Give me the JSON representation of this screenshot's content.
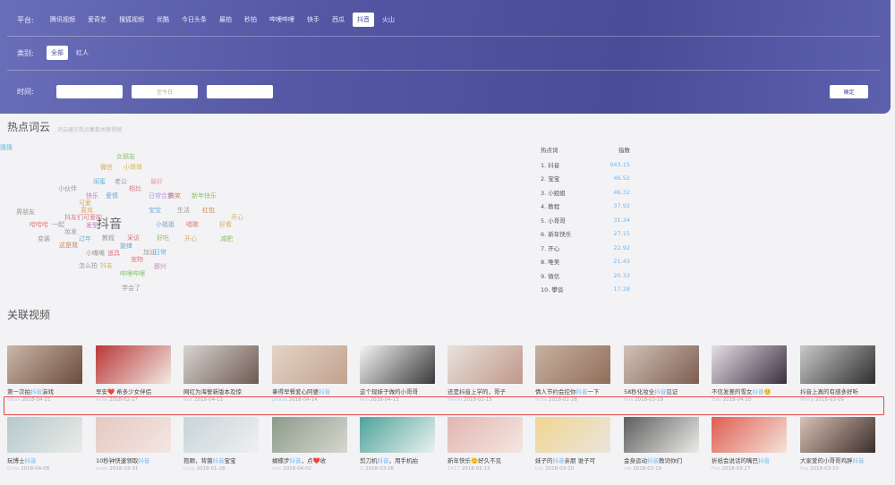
{
  "filters": {
    "platform": {
      "label": "平台:",
      "options": [
        "腾讯视频",
        "爱奇艺",
        "搜狐视频",
        "优酷",
        "今日头条",
        "最拍",
        "秒拍",
        "哔哩哔哩",
        "快手",
        "西瓜",
        "抖音",
        "火山"
      ],
      "active": "抖音"
    },
    "category": {
      "label": "类别:",
      "options": [
        "全部",
        "红人"
      ],
      "active": "全部"
    },
    "time": {
      "label": "时间:",
      "inputs": [
        "",
        "至今日",
        ""
      ],
      "confirm_label": "确定"
    }
  },
  "word_cloud": {
    "title": "热点词云",
    "note": "词云展示热点集数关联视频",
    "words": [
      {
        "text": "抖音",
        "color": "#666666",
        "big": true
      },
      {
        "text": "女朋友",
        "color": "#8bbf6c"
      },
      {
        "text": "微信",
        "color": "#e0a45a"
      },
      {
        "text": "小哥哥",
        "color": "#d9b34a"
      },
      {
        "text": "闺蜜",
        "color": "#6fb0d6"
      },
      {
        "text": "老公",
        "color": "#999999"
      },
      {
        "text": "最好",
        "color": "#e79c9c"
      },
      {
        "text": "小伙伴",
        "color": "#999999"
      },
      {
        "text": "快乐",
        "color": "#c27bc2"
      },
      {
        "text": "爱情",
        "color": "#77a3cc"
      },
      {
        "text": "相比",
        "color": "#e07777"
      },
      {
        "text": "可爱",
        "color": "#e0a45a"
      },
      {
        "text": "日常合集",
        "color": "#b995d9"
      },
      {
        "text": "搞笑",
        "color": "#cc8855"
      },
      {
        "text": "新年快乐",
        "color": "#8bbf6c"
      },
      {
        "text": "喜欢",
        "color": "#e0a45a"
      },
      {
        "text": "宝宝",
        "color": "#6fb0d6"
      },
      {
        "text": "生活",
        "color": "#999999"
      },
      {
        "text": "红包",
        "color": "#cc8855"
      },
      {
        "text": "男朋友",
        "color": "#999999"
      },
      {
        "text": "抖友们可爱的",
        "color": "#e07777"
      },
      {
        "text": "发型",
        "color": "#c27bc2"
      },
      {
        "text": "小姐姐",
        "color": "#77a3cc"
      },
      {
        "text": "教程",
        "color": "#999999"
      },
      {
        "text": "开心",
        "color": "#d9b34a"
      },
      {
        "text": "哈哈哈",
        "color": "#e07777"
      },
      {
        "text": "一起",
        "color": "#999999"
      },
      {
        "text": "妆发",
        "color": "#999999"
      },
      {
        "text": "唱歌",
        "color": "#e07777"
      },
      {
        "text": "好看",
        "color": "#d9b34a"
      },
      {
        "text": "变装",
        "color": "#999999"
      },
      {
        "text": "过年",
        "color": "#6fb0d6"
      },
      {
        "text": "采访",
        "color": "#e07777"
      },
      {
        "text": "好吃",
        "color": "#8bbf6c"
      },
      {
        "text": "开心",
        "color": "#e0a45a"
      },
      {
        "text": "减肥",
        "color": "#8bbf6c"
      },
      {
        "text": "这是我",
        "color": "#cc8855"
      },
      {
        "text": "旋律",
        "color": "#77a3cc"
      },
      {
        "text": "小嘴嘴",
        "color": "#999999"
      },
      {
        "text": "道具",
        "color": "#e07777"
      },
      {
        "text": "加油",
        "color": "#999999"
      },
      {
        "text": "日常",
        "color": "#6fb0d6"
      },
      {
        "text": "怎么拍",
        "color": "#999999"
      },
      {
        "text": "宠物",
        "color": "#e07777"
      },
      {
        "text": "抖友",
        "color": "#d9b34a"
      },
      {
        "text": "即兴",
        "color": "#c27bc2"
      },
      {
        "text": "哔哩哔哩",
        "color": "#8bbf6c"
      },
      {
        "text": "学会了",
        "color": "#999999"
      },
      {
        "text": "猜猜",
        "color": "#6fb0d6"
      }
    ]
  },
  "hot_words": {
    "header_word": "热点词",
    "header_heat": "指数",
    "rows": [
      {
        "rank": "1.",
        "word": "抖音",
        "heat": "943.15"
      },
      {
        "rank": "2.",
        "word": "宝宝",
        "heat": "46.52"
      },
      {
        "rank": "3.",
        "word": "小姐姐",
        "heat": "46.32"
      },
      {
        "rank": "4.",
        "word": "教程",
        "heat": "37.92"
      },
      {
        "rank": "5.",
        "word": "小哥哥",
        "heat": "31.34"
      },
      {
        "rank": "6.",
        "word": "新年快乐",
        "heat": "27.15"
      },
      {
        "rank": "7.",
        "word": "开心",
        "heat": "22.92"
      },
      {
        "rank": "8.",
        "word": "唯美",
        "heat": "21.43"
      },
      {
        "rank": "9.",
        "word": "微信",
        "heat": "20.32"
      },
      {
        "rank": "10.",
        "word": "攀谈",
        "heat": "17.28"
      }
    ]
  },
  "related_videos": {
    "title": "关联视频",
    "row1": [
      {
        "title_pre": "第一次拍",
        "title_hl": "抖音",
        "title_post": "演戏",
        "author": "eikan",
        "date": "2018-04-21"
      },
      {
        "title_pre": "早安❤️ 希多",
        "title_hl": "",
        "title_post": "少女伴侣",
        "author": "echo",
        "date": "2018-02-27"
      },
      {
        "title_pre": "网红为海誓新版本及惊",
        "title_hl": "",
        "title_post": "",
        "author": "fast",
        "date": "2018-04-11"
      },
      {
        "title_pre": "拿得早餐爱心阿婆",
        "title_hl": "抖音",
        "title_post": "",
        "author": "pitaus",
        "date": "2018-04-14"
      },
      {
        "title_pre": "这个现妹子做的小哥哥",
        "title_hl": "",
        "title_post": "",
        "author": "ken",
        "date": "2018-04-13"
      },
      {
        "title_pre": "还是抖音上学的，哥子",
        "title_hl": "",
        "title_post": "",
        "author": "Yahoo",
        "date": "2018-02-15"
      },
      {
        "title_pre": "情人节约会控你",
        "title_hl": "抖音",
        "title_post": "一下",
        "author": "echo",
        "date": "2018-02-26"
      },
      {
        "title_pre": "58秒化妆全",
        "title_hl": "抖音",
        "title_post": "见证",
        "author": "mia",
        "date": "2018-03-19"
      },
      {
        "title_pre": "不信发差的雪女",
        "title_hl": "抖音",
        "title_post": "🙂",
        "author": "Yuki",
        "date": "2018-04-10"
      },
      {
        "title_pre": "抖音上真的有感多好听",
        "title_hl": "",
        "title_post": "",
        "author": "Meng",
        "date": "2018-03-09"
      }
    ],
    "row2": [
      {
        "title_pre": "玩博士",
        "title_hl": "抖音",
        "title_post": "",
        "author": "Echo",
        "date": "2018-04-08"
      },
      {
        "title_pre": "10秒钟快速领取",
        "title_hl": "抖音",
        "title_post": "",
        "author": "yuan",
        "date": "2018-03-31"
      },
      {
        "title_pre": "抱颗，背菌",
        "title_hl": "抖音",
        "title_post": "宝宝",
        "author": "Lucy",
        "date": "2018-01-28"
      },
      {
        "title_pre": "蝴蝶步",
        "title_hl": "抖音",
        "title_post": "，点❤️收",
        "author": "min",
        "date": "2018-04-02"
      },
      {
        "title_pre": "剪刀机",
        "title_hl": "抖音",
        "title_post": "，用手机拍",
        "author": "Q",
        "date": "2018-03-26"
      },
      {
        "title_pre": "新年快乐🙂好久不见",
        "title_hl": "",
        "title_post": "",
        "author": "1417",
        "date": "2018-02-15"
      },
      {
        "title_pre": "妹子的",
        "title_hl": "抖音",
        "title_post": "亲朋 谁子可",
        "author": "Lily",
        "date": "2018-03-20"
      },
      {
        "title_pre": "金身运动",
        "title_hl": "抖音",
        "title_post": "教词你们",
        "author": "cat",
        "date": "2018-02-19"
      },
      {
        "title_pre": "折纸会说话的嘴巴",
        "title_hl": "抖音",
        "title_post": "",
        "author": "Fun",
        "date": "2018-03-27"
      },
      {
        "title_pre": "大家爱的小哥哥鸡胖",
        "title_hl": "抖音",
        "title_post": "",
        "author": "lisa",
        "date": "2018-03-10"
      }
    ]
  }
}
